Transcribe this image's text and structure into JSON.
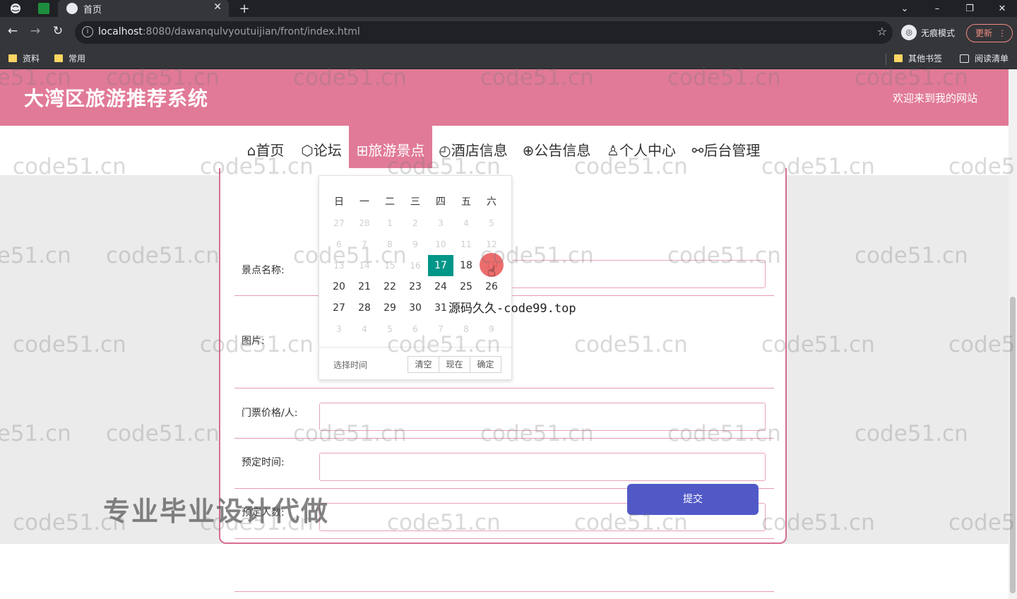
{
  "browser": {
    "tab_title": "首页",
    "tab_close": "✕",
    "new_tab": "+",
    "url_host": "localhost",
    "url_path": ":8080/dawanqulvyoutuijian/front/index.html",
    "incognito_label": "无痕模式",
    "update_label": "更新",
    "bookmarks": [
      "资料",
      "常用"
    ],
    "bookmarks_right": [
      "其他书签",
      "阅读清单"
    ]
  },
  "site": {
    "title": "大湾区旅游推荐系统",
    "welcome": "欢迎来到我的网站"
  },
  "nav": {
    "items": [
      {
        "icon": "⌂",
        "label": "首页"
      },
      {
        "icon": "⬡",
        "label": "论坛"
      },
      {
        "icon": "⊞",
        "label": "旅游景点"
      },
      {
        "icon": "◴",
        "label": "酒店信息"
      },
      {
        "icon": "⊕",
        "label": "公告信息"
      },
      {
        "icon": "♙",
        "label": "个人中心"
      },
      {
        "icon": "⚯",
        "label": "后台管理"
      }
    ],
    "active_index": 2
  },
  "form": {
    "fields": [
      {
        "label": "景点名称:"
      },
      {
        "label": "图片:"
      },
      {
        "label": "门票价格/人:"
      },
      {
        "label": "预定时间:"
      },
      {
        "label": "预定人数:"
      }
    ],
    "submit_label": "提交"
  },
  "datepicker": {
    "weekdays": [
      "日",
      "一",
      "二",
      "三",
      "四",
      "五",
      "六"
    ],
    "weeks": [
      [
        "27",
        "28",
        "1",
        "2",
        "3",
        "4",
        "5"
      ],
      [
        "6",
        "7",
        "8",
        "9",
        "10",
        "11",
        "12"
      ],
      [
        "13",
        "14",
        "15",
        "16",
        "17",
        "18",
        "19"
      ],
      [
        "20",
        "21",
        "22",
        "23",
        "24",
        "25",
        "26"
      ],
      [
        "27",
        "28",
        "29",
        "30",
        "31",
        "1",
        "2"
      ],
      [
        "3",
        "4",
        "5",
        "6",
        "7",
        "8",
        "9"
      ]
    ],
    "selected_day": "17",
    "footer_hint": "选择时间",
    "buttons": [
      "清空",
      "现在",
      "确定"
    ]
  },
  "overlays": {
    "code_text": "源码久久-code99.top",
    "promo_text": "专业毕业设计代做",
    "watermark": "code51.cn"
  },
  "colors": {
    "brand_pink": "#e17a97",
    "selected_green": "#009688",
    "submit_blue": "#5159c7"
  }
}
